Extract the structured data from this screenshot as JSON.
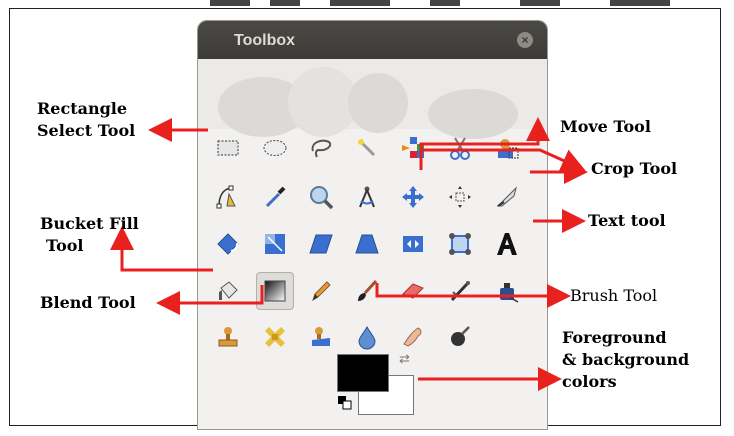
{
  "window": {
    "title": "Toolbox"
  },
  "tools": [
    {
      "name": "rectangle-select-tool",
      "icon": "rect-select"
    },
    {
      "name": "ellipse-select-tool",
      "icon": "ellipse-select"
    },
    {
      "name": "free-select-tool",
      "icon": "lasso"
    },
    {
      "name": "fuzzy-select-tool",
      "icon": "magic-wand"
    },
    {
      "name": "select-by-color-tool",
      "icon": "color-select"
    },
    {
      "name": "scissors-select-tool",
      "icon": "scissors"
    },
    {
      "name": "foreground-select-tool",
      "icon": "fg-select"
    },
    {
      "name": "paths-tool",
      "icon": "paths"
    },
    {
      "name": "color-picker-tool",
      "icon": "eyedropper"
    },
    {
      "name": "zoom-tool",
      "icon": "magnifier"
    },
    {
      "name": "measure-tool",
      "icon": "compass"
    },
    {
      "name": "move-tool",
      "icon": "move-cross"
    },
    {
      "name": "alignment-tool",
      "icon": "align"
    },
    {
      "name": "crop-tool",
      "icon": "crop-knife"
    },
    {
      "name": "rotate-tool",
      "icon": "rotate"
    },
    {
      "name": "scale-tool",
      "icon": "scale"
    },
    {
      "name": "shear-tool",
      "icon": "shear"
    },
    {
      "name": "perspective-tool",
      "icon": "perspective"
    },
    {
      "name": "flip-tool",
      "icon": "flip"
    },
    {
      "name": "cage-transform-tool",
      "icon": "cage"
    },
    {
      "name": "text-tool",
      "icon": "text-A"
    },
    {
      "name": "bucket-fill-tool",
      "icon": "bucket"
    },
    {
      "name": "blend-tool",
      "icon": "gradient"
    },
    {
      "name": "pencil-tool",
      "icon": "pencil"
    },
    {
      "name": "paintbrush-tool",
      "icon": "brush"
    },
    {
      "name": "eraser-tool",
      "icon": "eraser"
    },
    {
      "name": "airbrush-tool",
      "icon": "airbrush"
    },
    {
      "name": "ink-tool",
      "icon": "ink"
    },
    {
      "name": "clone-tool",
      "icon": "stamp"
    },
    {
      "name": "heal-tool",
      "icon": "bandage"
    },
    {
      "name": "perspective-clone-tool",
      "icon": "persp-stamp"
    },
    {
      "name": "blur-sharpen-tool",
      "icon": "drop"
    },
    {
      "name": "smudge-tool",
      "icon": "finger"
    },
    {
      "name": "dodge-burn-tool",
      "icon": "dodge"
    }
  ],
  "colors": {
    "foreground": "#000000",
    "background": "#ffffff",
    "annotation": "#e8211f"
  },
  "labels": {
    "rectangle_line1": "Rectangle",
    "rectangle_line2": "Select Tool",
    "bucket_line1": "Bucket Fill",
    "bucket_line2": "Tool",
    "blend": "Blend Tool",
    "move": "Move Tool",
    "crop": "Crop Tool",
    "text": "Text tool",
    "brush": "Brush Tool",
    "fgbg_line1": "Foreground",
    "fgbg_line2": "& background",
    "fgbg_line3": "colors"
  }
}
